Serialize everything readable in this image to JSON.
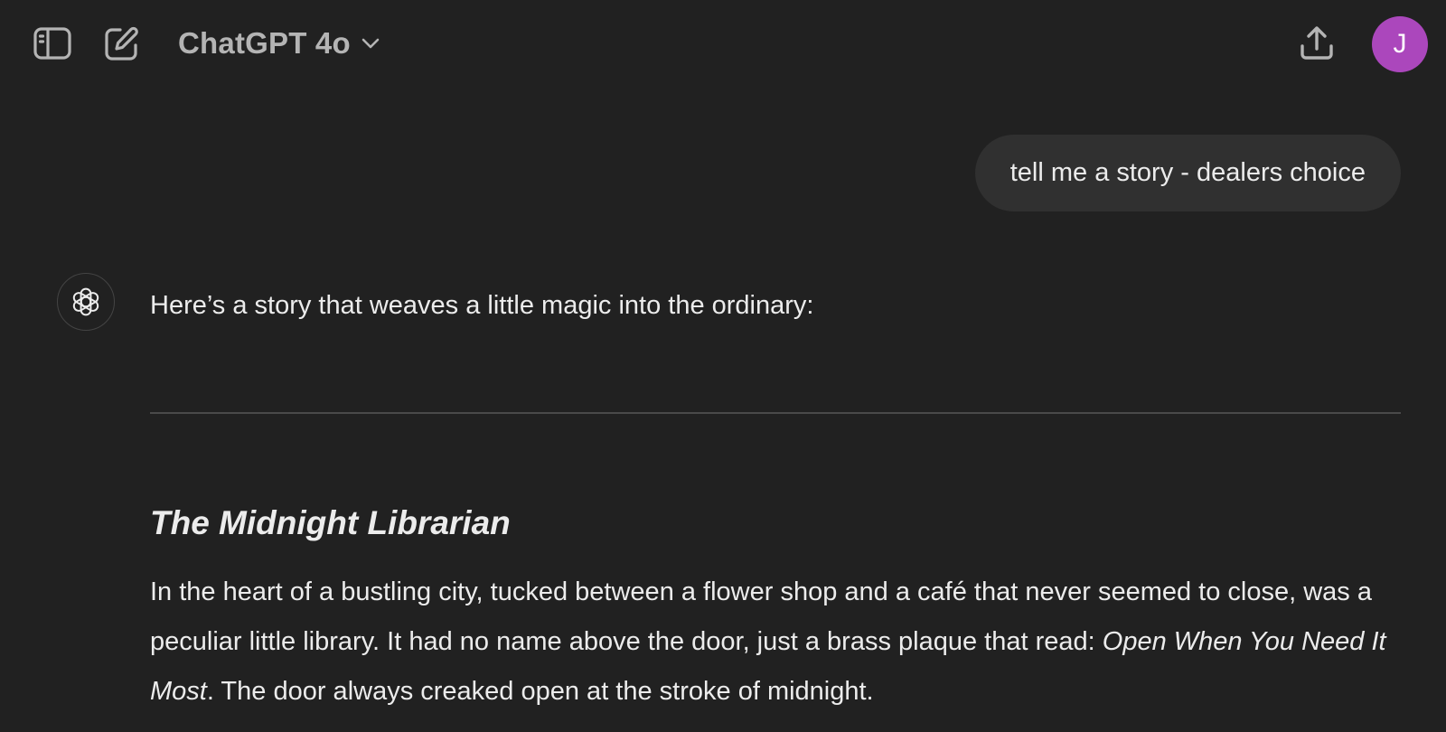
{
  "header": {
    "sidebar_toggle_icon": "sidebar-toggle-icon",
    "new_chat_icon": "new-chat-icon",
    "model_name": "ChatGPT 4o",
    "model_dropdown_icon": "chevron-down-icon",
    "share_icon": "share-upload-icon",
    "avatar_initial": "J",
    "avatar_color": "#ab47bc"
  },
  "conversation": {
    "user_message": "tell me a story - dealers choice",
    "assistant": {
      "icon": "openai-logo-icon",
      "intro": "Here’s a story that weaves a little magic into the ordinary:",
      "story_title": "The Midnight Librarian",
      "paragraph": {
        "part1": "In the heart of a bustling city, tucked between a flower shop and a café that never seemed to close, was a peculiar little library. It had no name above the door, just a brass plaque that read: ",
        "plaque": "Open When You Need It Most",
        "part2": ". The door always creaked open at the stroke of midnight."
      }
    }
  },
  "colors": {
    "background": "#212121",
    "bubble": "#303030",
    "text": "#ececec",
    "muted": "#b4b4b4",
    "divider": "#4a4a4a"
  }
}
